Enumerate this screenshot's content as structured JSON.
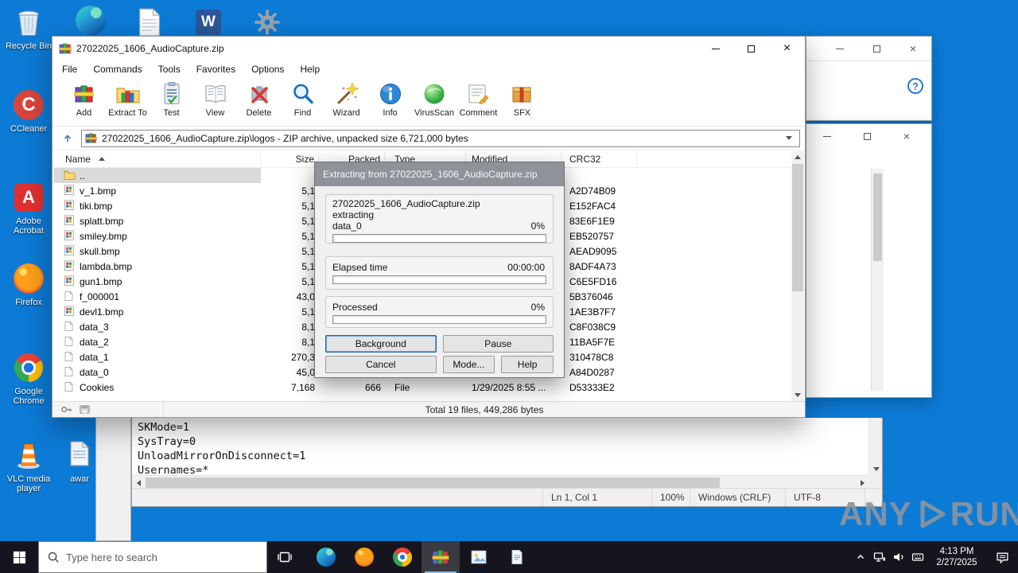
{
  "colors": {
    "accent": "#0078d7",
    "desktop": "#0c7bd6",
    "taskbar": "#15151f",
    "dialog_title": "#8f9299",
    "selection": "#d9d9d9"
  },
  "desktop": {
    "icons": [
      {
        "label": "Recycle Bin"
      },
      {
        "label": "CCleaner"
      },
      {
        "label": "Adobe Acrobat"
      },
      {
        "label": "Firefox"
      },
      {
        "label": "Google Chrome"
      },
      {
        "label": "VLC media player"
      }
    ],
    "partial_icon_label": "awar"
  },
  "winrar": {
    "title": "27022025_1606_AudioCapture.zip",
    "menu": [
      "File",
      "Commands",
      "Tools",
      "Favorites",
      "Options",
      "Help"
    ],
    "toolbar": [
      "Add",
      "Extract To",
      "Test",
      "View",
      "Delete",
      "Find",
      "Wizard",
      "Info",
      "VirusScan",
      "Comment",
      "SFX"
    ],
    "address": "27022025_1606_AudioCapture.zip\\logos - ZIP archive, unpacked size 6,721,000 bytes",
    "columns": [
      "Name",
      "Size",
      "Packed",
      "Type",
      "Modified",
      "CRC32"
    ],
    "rows": [
      {
        "icon": "folder",
        "name": "..",
        "selected": true
      },
      {
        "icon": "bmp",
        "name": "v_1.bmp",
        "size": "5,1",
        "crc": "A2D74B09"
      },
      {
        "icon": "bmp",
        "name": "tiki.bmp",
        "size": "5,1",
        "crc": "E152FAC4"
      },
      {
        "icon": "bmp",
        "name": "splatt.bmp",
        "size": "5,1",
        "crc": "83E6F1E9"
      },
      {
        "icon": "bmp",
        "name": "smiley.bmp",
        "size": "5,1",
        "crc": "EB520757"
      },
      {
        "icon": "bmp",
        "name": "skull.bmp",
        "size": "5,1",
        "crc": "AEAD9095"
      },
      {
        "icon": "bmp",
        "name": "lambda.bmp",
        "size": "5,1",
        "crc": "8ADF4A73"
      },
      {
        "icon": "bmp",
        "name": "gun1.bmp",
        "size": "5,1",
        "crc": "C6E5FD16"
      },
      {
        "icon": "file",
        "name": "f_000001",
        "size": "43,0",
        "crc": "5B376046"
      },
      {
        "icon": "bmp",
        "name": "devl1.bmp",
        "size": "5,1",
        "crc": "1AE3B7F7"
      },
      {
        "icon": "file",
        "name": "data_3",
        "size": "8,1",
        "crc": "C8F038C9"
      },
      {
        "icon": "file",
        "name": "data_2",
        "size": "8,1",
        "crc": "11BA5F7E"
      },
      {
        "icon": "file",
        "name": "data_1",
        "size": "270,3",
        "crc": "310478C8"
      },
      {
        "icon": "file",
        "name": "data_0",
        "size": "45,0",
        "crc": "A84D0287"
      },
      {
        "icon": "file",
        "name": "Cookies",
        "size": "7,168",
        "packed": "666",
        "type": "File",
        "modified": "1/29/2025 8:55 ...",
        "crc": "D53333E2"
      }
    ],
    "status_total": "Total 19 files, 449,286 bytes"
  },
  "dialog": {
    "title": "Extracting from 27022025_1606_AudioCapture.zip",
    "archive": "27022025_1606_AudioCapture.zip",
    "action": "extracting",
    "file": "data_0",
    "file_pct": "0%",
    "elapsed_label": "Elapsed time",
    "elapsed": "00:00:00",
    "processed_label": "Processed",
    "processed_pct": "0%",
    "buttons": [
      "Background",
      "Pause",
      "Cancel",
      "Mode...",
      "Help"
    ]
  },
  "notepad": {
    "lines": [
      "SKMode=1",
      "SysTray=0",
      "UnloadMirrorOnDisconnect=1",
      "Usernames=*"
    ],
    "status": {
      "position": "Ln 1, Col 1",
      "zoom": "100%",
      "line_ending": "Windows (CRLF)",
      "encoding": "UTF-8"
    }
  },
  "taskbar": {
    "search_placeholder": "Type here to search",
    "time": "4:13 PM",
    "date": "2/27/2025"
  },
  "watermark": {
    "left": "ANY",
    "right": "RUN"
  }
}
